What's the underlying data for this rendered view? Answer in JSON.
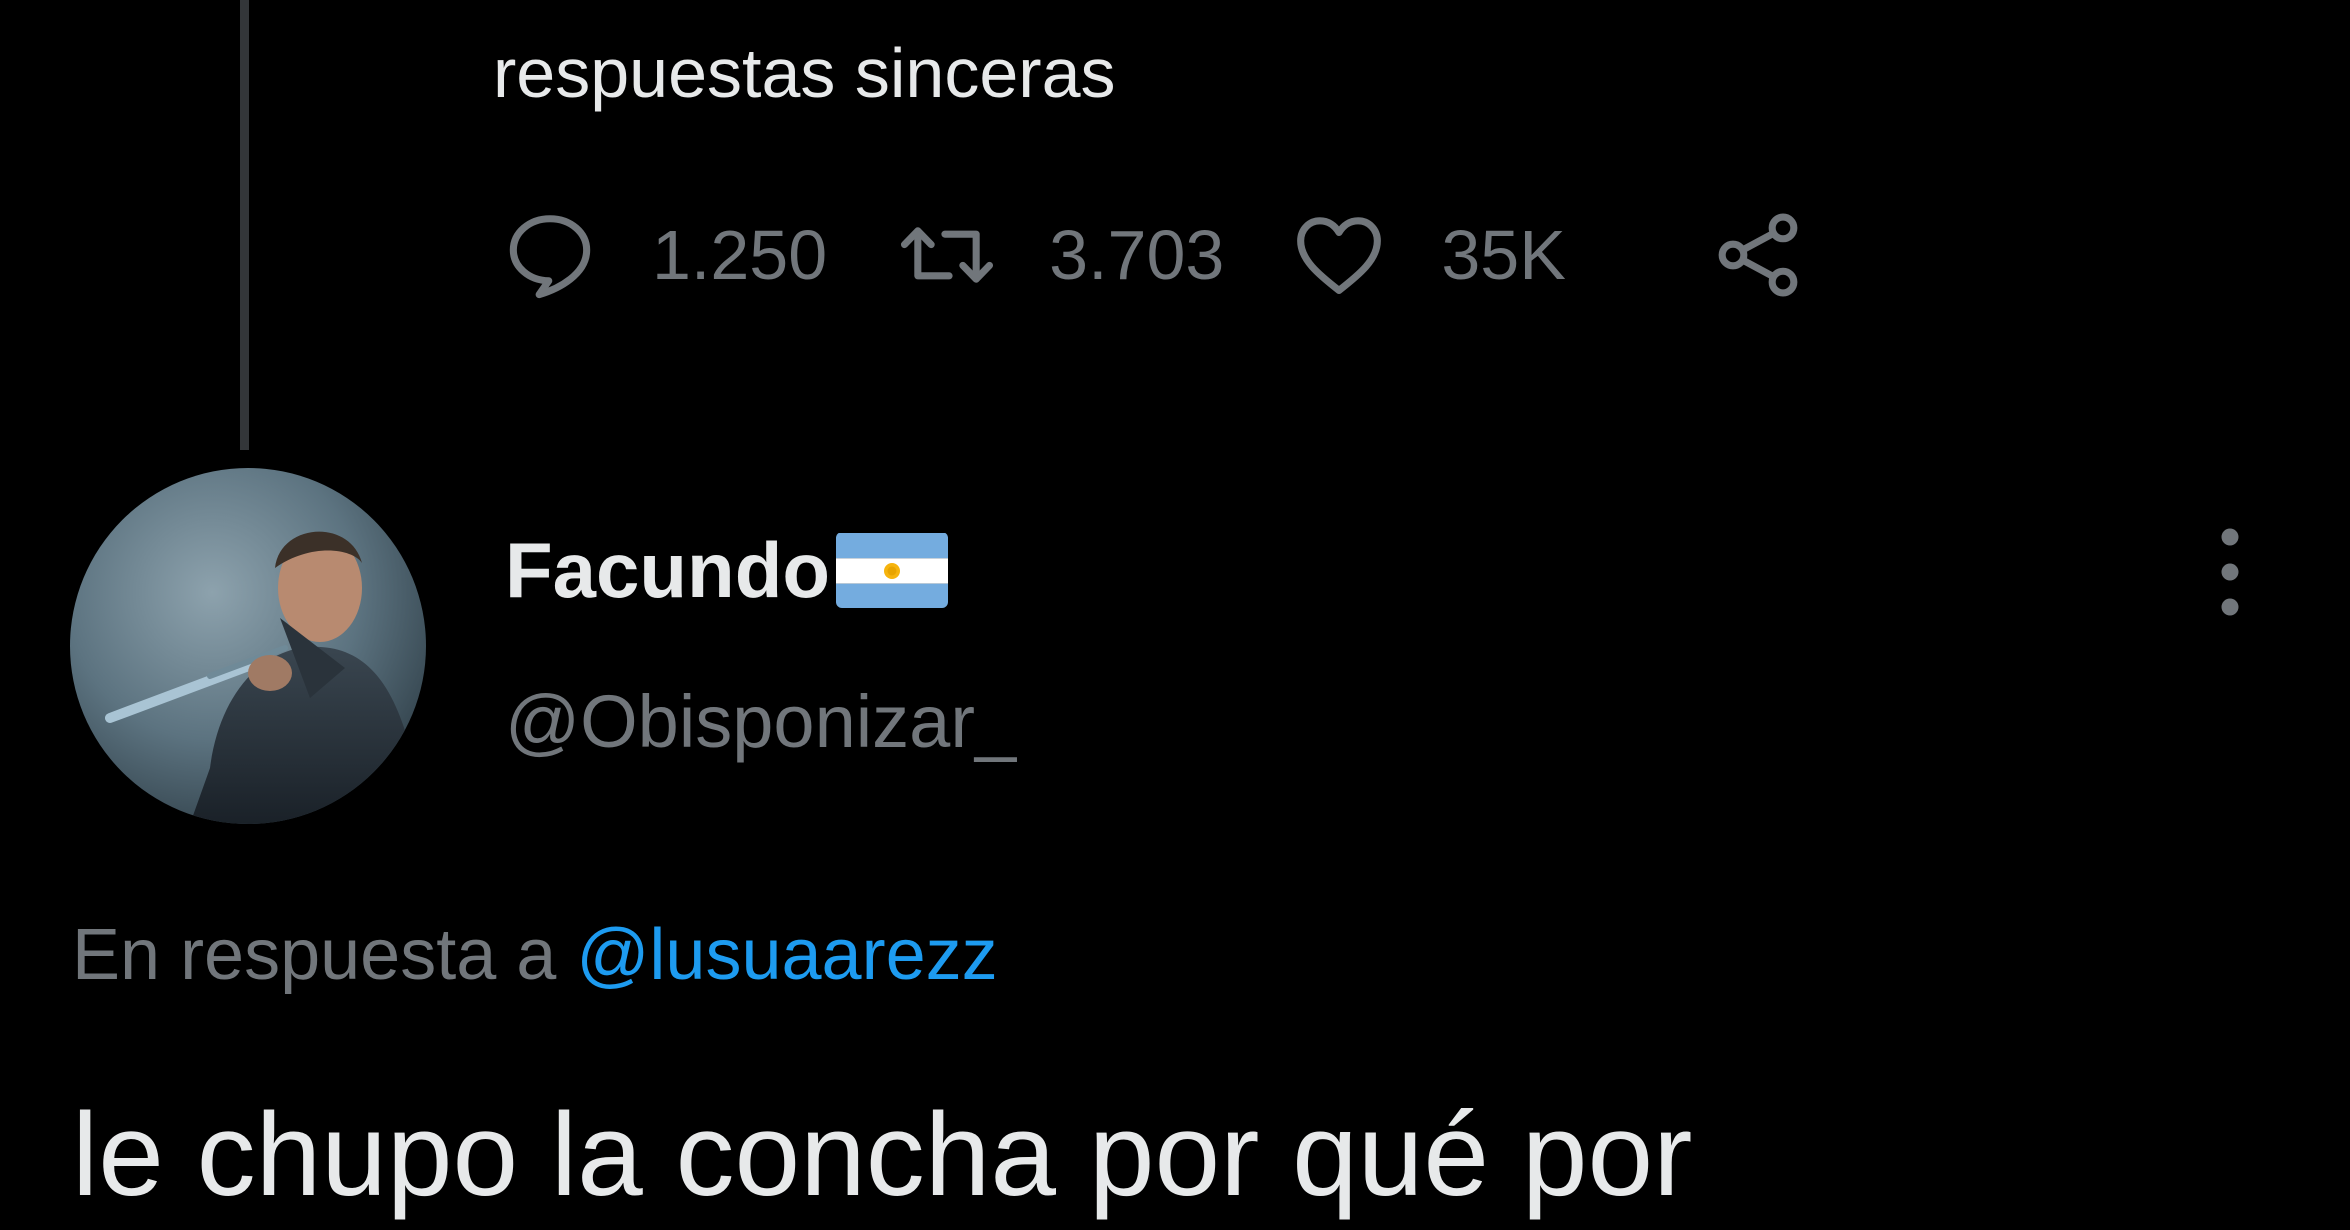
{
  "previous_tweet": {
    "text_tail": "respuestas sinceras",
    "stats": {
      "replies": "1.250",
      "retweets": "3.703",
      "likes": "35K"
    },
    "icons": [
      "reply-icon",
      "retweet-icon",
      "like-icon",
      "share-icon"
    ]
  },
  "reply": {
    "author": {
      "display_name": "Facundo",
      "handle": "@Obisponizar_",
      "flag_icon": "argentina-flag-icon",
      "avatar": "profile-photo"
    },
    "reply_context_prefix": "En respuesta a ",
    "reply_context_mention": "@lusuaarezz",
    "text": "le chupo la concha por qué por",
    "menu_icon": "more-options-icon"
  },
  "colors": {
    "background": "#000000",
    "text_primary": "#e7e9ea",
    "text_secondary": "#71767b",
    "link": "#1d9bf0",
    "thread_line": "#333639"
  }
}
